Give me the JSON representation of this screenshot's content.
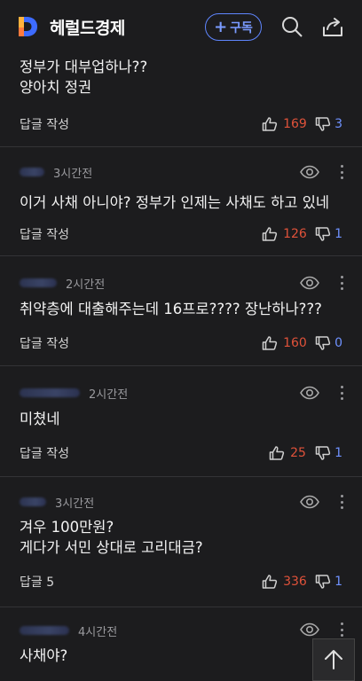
{
  "header": {
    "brand": "헤럴드경제",
    "subscribe_plus": "+",
    "subscribe_label": "구독",
    "colors": {
      "accent": "#5f86ff",
      "logo_blue": "#3d6bff",
      "logo_orange": "#ff7a3d"
    },
    "icons": [
      "search-icon",
      "share-icon"
    ]
  },
  "comments": [
    {
      "time": "",
      "text": "정부가 대부업하나??\n양아치 정권",
      "reply": "답글 작성",
      "up": "169",
      "down": "3"
    },
    {
      "time": "3시간전",
      "text": "이거 사채 아니야? 정부가 인제는 사채도 하고 있네",
      "reply": "답글 작성",
      "up": "126",
      "down": "1"
    },
    {
      "time": "2시간전",
      "text": "취약층에 대출해주는데 16프로???? 장난하나???",
      "reply": "답글 작성",
      "up": "160",
      "down": "0"
    },
    {
      "time": "2시간전",
      "text": "미쳤네",
      "reply": "답글 작성",
      "up": "25",
      "down": "1"
    },
    {
      "time": "3시간전",
      "text": "겨우 100만원?\n게다가 서민 상대로 고리대금?",
      "reply": "답글 5",
      "up": "336",
      "down": "1"
    },
    {
      "time": "4시간전",
      "text": "사채야?",
      "reply": "",
      "up": "",
      "down": ""
    }
  ],
  "scroll_top": {
    "icon": "arrow-up-icon"
  }
}
